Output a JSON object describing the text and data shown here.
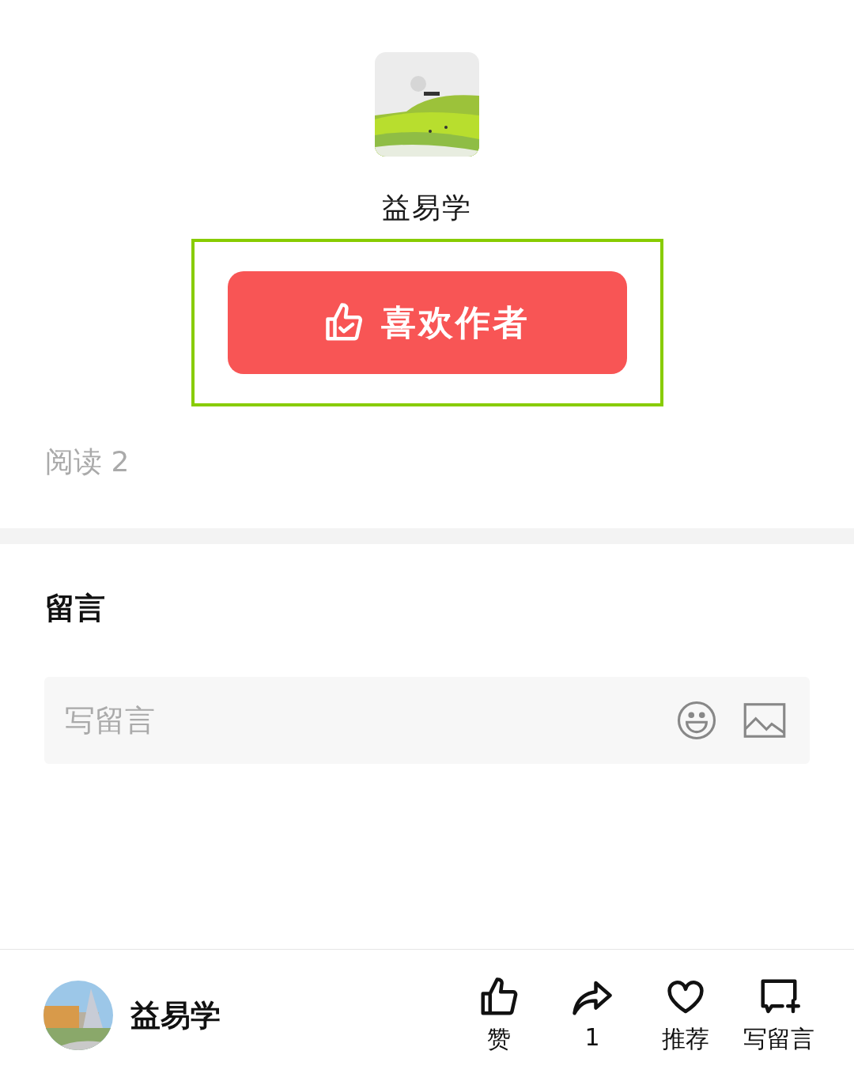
{
  "author": {
    "name": "益易学"
  },
  "like_author_button": {
    "label": "喜欢作者",
    "highlighted": true
  },
  "read_count": "阅读 2",
  "comments": {
    "title": "留言",
    "input": {
      "placeholder": "写留言"
    }
  },
  "bottom_bar": {
    "account_name": "益易学",
    "actions": [
      {
        "kind": "like",
        "label": "赞"
      },
      {
        "kind": "share",
        "label": "1"
      },
      {
        "kind": "recommend",
        "label": "推荐"
      },
      {
        "kind": "comment",
        "label": "写留言"
      }
    ]
  }
}
